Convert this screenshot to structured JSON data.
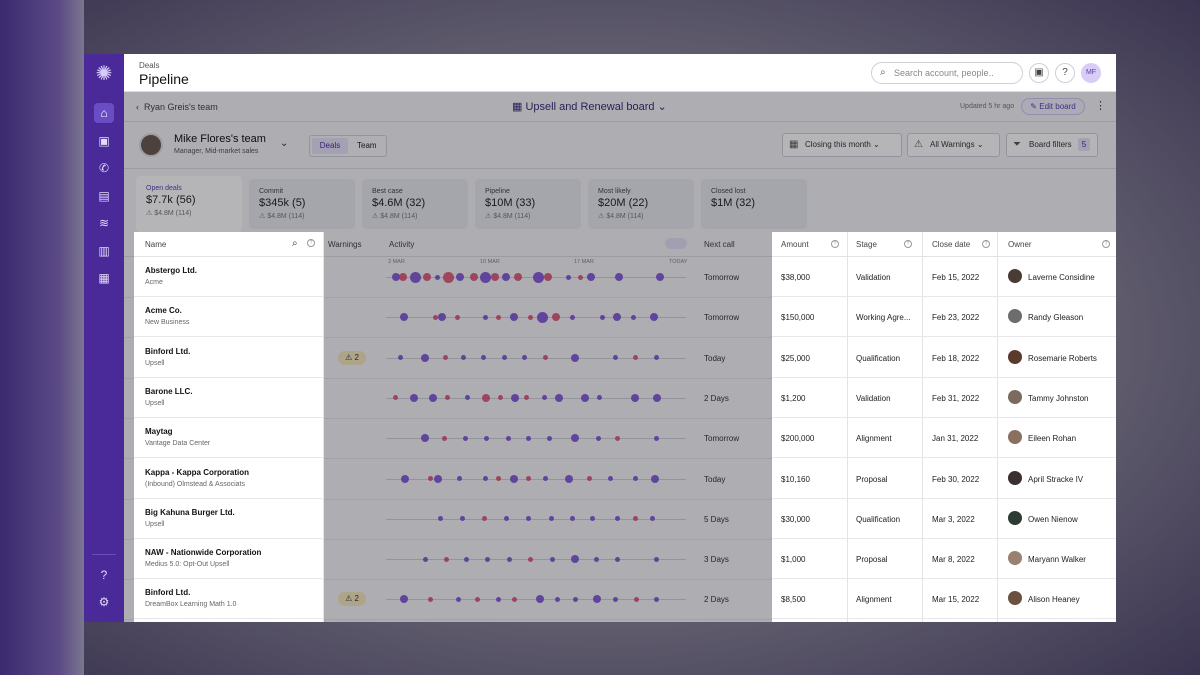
{
  "header": {
    "section": "Deals",
    "title": "Pipeline",
    "search_placeholder": "Search account, people..",
    "avatar_initials": "MF"
  },
  "nav": {
    "back_label": "Ryan Greis's team",
    "board_title": "Upsell and Renewal board",
    "updated": "Updated 5 hr ago",
    "edit_board": "Edit board"
  },
  "manager": {
    "name": "Mike Flores's team",
    "role": "Manager, Mid-market sales"
  },
  "view_tabs": [
    "Deals",
    "Team"
  ],
  "filters": {
    "closing": "Closing this month",
    "warnings": "All Warnings",
    "board_filters": "Board filters",
    "board_filters_count": "5"
  },
  "summary_cards": [
    {
      "title": "Open deals",
      "value": "$7.7k (56)",
      "warn": "⚠ $4.8M (114)"
    },
    {
      "title": "Commit",
      "value": "$345k (5)",
      "warn": "⚠ $4.8M (114)"
    },
    {
      "title": "Best case",
      "value": "$4.6M (32)",
      "warn": "⚠ $4.8M (114)"
    },
    {
      "title": "Pipeline",
      "value": "$10M (33)",
      "warn": "⚠ $4.8M (114)"
    },
    {
      "title": "Most likely",
      "value": "$20M (22)",
      "warn": "⚠ $4.8M (114)"
    },
    {
      "title": "Closed lost",
      "value": "$1M (32)",
      "warn": ""
    }
  ],
  "columns": {
    "name": "Name",
    "warnings": "Warnings",
    "activity": "Activity",
    "next_call": "Next call",
    "amount": "Amount",
    "stage": "Stage",
    "close_date": "Close date",
    "owner": "Owner"
  },
  "activity_dates": [
    "3 MAR",
    "10 MAR",
    "17 MAR",
    "TODAY"
  ],
  "rows": [
    {
      "name": "Abstergo Ltd.",
      "sub": "Acme",
      "warning": "",
      "next_call": "Tomorrow",
      "amount": "$38,000",
      "stage": "Validation",
      "close_date": "Feb 15, 2022",
      "owner": "Laverne Considine"
    },
    {
      "name": "Acme Co.",
      "sub": "New Business",
      "warning": "",
      "next_call": "Tomorrow",
      "amount": "$150,000",
      "stage": "Working Agre...",
      "close_date": "Feb 23, 2022",
      "owner": "Randy Gleason"
    },
    {
      "name": "Binford Ltd.",
      "sub": "Upsell",
      "warning": "2",
      "next_call": "Today",
      "amount": "$25,000",
      "stage": "Qualification",
      "close_date": "Feb 18, 2022",
      "owner": "Rosemarie Roberts"
    },
    {
      "name": "Barone LLC.",
      "sub": "Upsell",
      "warning": "",
      "next_call": "2 Days",
      "amount": "$1,200",
      "stage": "Validation",
      "close_date": "Feb 31, 2022",
      "owner": "Tammy Johnston"
    },
    {
      "name": "Maytag",
      "sub": "Vantage Data Center",
      "warning": "",
      "next_call": "Tomorrow",
      "amount": "$200,000",
      "stage": "Alignment",
      "close_date": "Jan 31, 2022",
      "owner": "Eileen Rohan"
    },
    {
      "name": "Kappa - Kappa Corporation",
      "sub": "(Inbound) Olmstead & Associats",
      "warning": "",
      "next_call": "Today",
      "amount": "$10,160",
      "stage": "Proposal",
      "close_date": "Feb 30, 2022",
      "owner": "April Stracke IV"
    },
    {
      "name": "Big Kahuna Burger Ltd.",
      "sub": "Upsell",
      "warning": "",
      "next_call": "5 Days",
      "amount": "$30,000",
      "stage": "Qualification",
      "close_date": "Mar 3, 2022",
      "owner": "Owen Nienow"
    },
    {
      "name": "NAW - Nationwide Corporation",
      "sub": "Medius 5.0: Opt-Out Upsell",
      "warning": "",
      "next_call": "3 Days",
      "amount": "$1,000",
      "stage": "Proposal",
      "close_date": "Mar 8, 2022",
      "owner": "Maryann Walker"
    },
    {
      "name": "Binford Ltd.",
      "sub": "DreamBox Learning Math 1.0",
      "warning": "2",
      "next_call": "2 Days",
      "amount": "$8,500",
      "stage": "Alignment",
      "close_date": "Mar 15, 2022",
      "owner": "Alison Heaney"
    }
  ],
  "colors": {
    "accent": "#4a2a99",
    "purple_dot": "#7b4fd6",
    "red_dot": "#d9456a"
  }
}
